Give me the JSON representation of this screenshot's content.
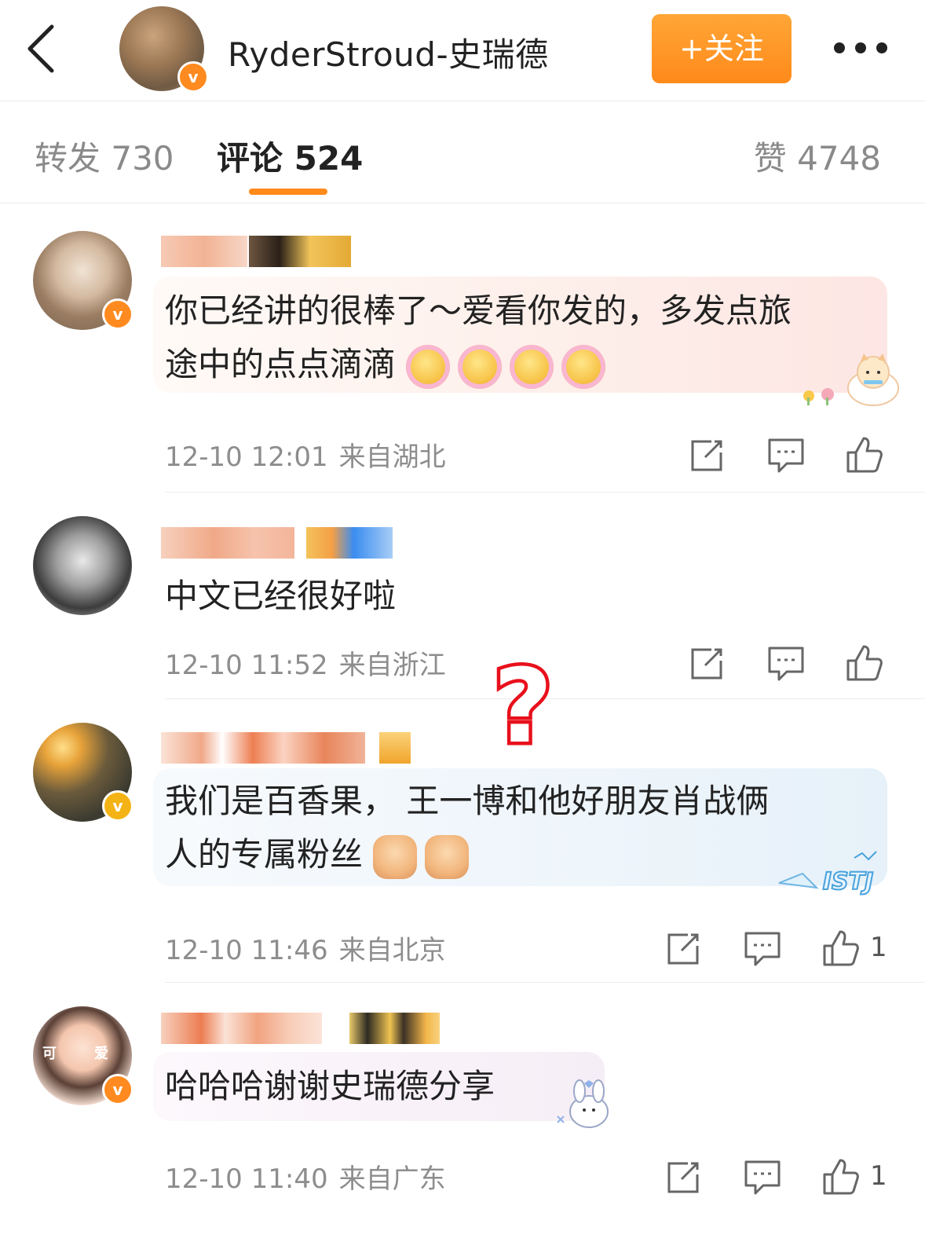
{
  "header": {
    "user_name": "RyderStroud-史瑞德",
    "follow_label": "+关注",
    "verified_mark": "v"
  },
  "tabs": [
    {
      "label": "转发 730",
      "active": false
    },
    {
      "label": "评论 524",
      "active": true
    },
    {
      "label": "赞 4748",
      "active": false
    }
  ],
  "comments": [
    {
      "text_lines": [
        "你已经讲的很棒了～爱看你发的，多发点旅",
        "途中的点点滴滴"
      ],
      "emoji": [
        "flower-smile-emoji",
        "flower-smile-emoji",
        "flower-smile-emoji",
        "flower-smile-emoji"
      ],
      "time": "12-10 12:01",
      "location": "来自湖北",
      "like_count": ""
    },
    {
      "text_lines": [
        "中文已经很好啦"
      ],
      "emoji": [],
      "time": "12-10 11:52",
      "location": "来自浙江",
      "like_count": ""
    },
    {
      "text_lines": [
        "我们是百香果， 王一博和他好朋友肖战俩",
        "人的专属粉丝"
      ],
      "emoji": [
        "fist-emoji",
        "fist-emoji"
      ],
      "time": "12-10 11:46",
      "location": "来自北京",
      "like_count": "1"
    },
    {
      "text_lines": [
        "哈哈哈谢谢史瑞德分享"
      ],
      "emoji": [],
      "time": "12-10 11:40",
      "location": "来自广东",
      "like_count": "1"
    }
  ],
  "stickers": {
    "bubble3_tag": "ISTJ",
    "avatar4_text_left": "可",
    "avatar4_text_right": "爱"
  },
  "annotation": {
    "symbol": "?",
    "color": "#e8101c"
  },
  "colors": {
    "accent": "#ff8a1a",
    "verified": "#ff8a1f",
    "verified_gold": "#f3b314",
    "meta": "#8d8d8d"
  }
}
